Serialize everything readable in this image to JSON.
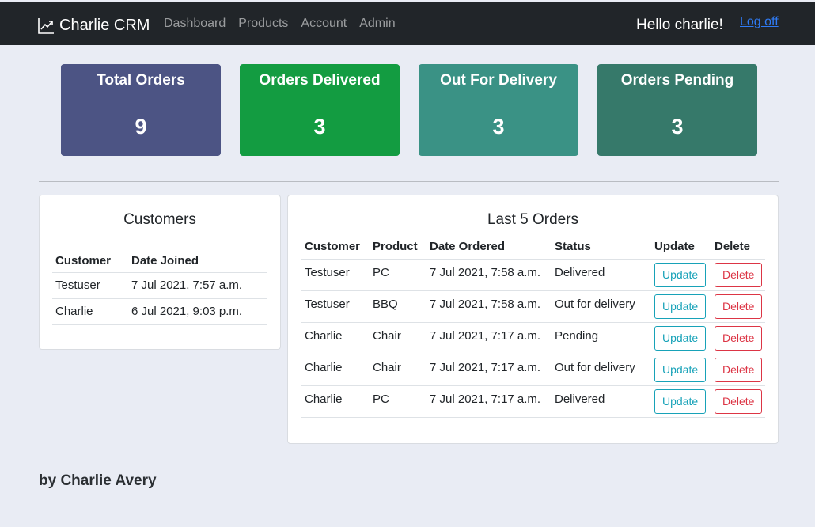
{
  "navbar": {
    "brand": "Charlie CRM",
    "brand_icon": "chart-line-icon",
    "links": [
      "Dashboard",
      "Products",
      "Account",
      "Admin"
    ],
    "greeting": "Hello charlie!",
    "logoff": "Log off"
  },
  "stats": [
    {
      "label": "Total Orders",
      "value": "9",
      "color": "#4c5484"
    },
    {
      "label": "Orders Delivered",
      "value": "3",
      "color": "#139c41"
    },
    {
      "label": "Out For Delivery",
      "value": "3",
      "color": "#3a9285"
    },
    {
      "label": "Orders Pending",
      "value": "3",
      "color": "#36796a"
    }
  ],
  "customers": {
    "title": "Customers",
    "headers": [
      "Customer",
      "Date Joined"
    ],
    "rows": [
      [
        "Testuser",
        "7 Jul 2021, 7:57 a.m."
      ],
      [
        "Charlie",
        "6 Jul 2021, 9:03 p.m."
      ]
    ]
  },
  "orders": {
    "title": "Last 5 Orders",
    "headers": [
      "Customer",
      "Product",
      "Date Ordered",
      "Status",
      "Update",
      "Delete"
    ],
    "update_label": "Update",
    "delete_label": "Delete",
    "rows": [
      [
        "Testuser",
        "PC",
        "7 Jul 2021, 7:58 a.m.",
        "Delivered"
      ],
      [
        "Testuser",
        "BBQ",
        "7 Jul 2021, 7:58 a.m.",
        "Out for delivery"
      ],
      [
        "Charlie",
        "Chair",
        "7 Jul 2021, 7:17 a.m.",
        "Pending"
      ],
      [
        "Charlie",
        "Chair",
        "7 Jul 2021, 7:17 a.m.",
        "Out for delivery"
      ],
      [
        "Charlie",
        "PC",
        "7 Jul 2021, 7:17 a.m.",
        "Delivered"
      ]
    ]
  },
  "footer": {
    "text": "by Charlie Avery"
  }
}
